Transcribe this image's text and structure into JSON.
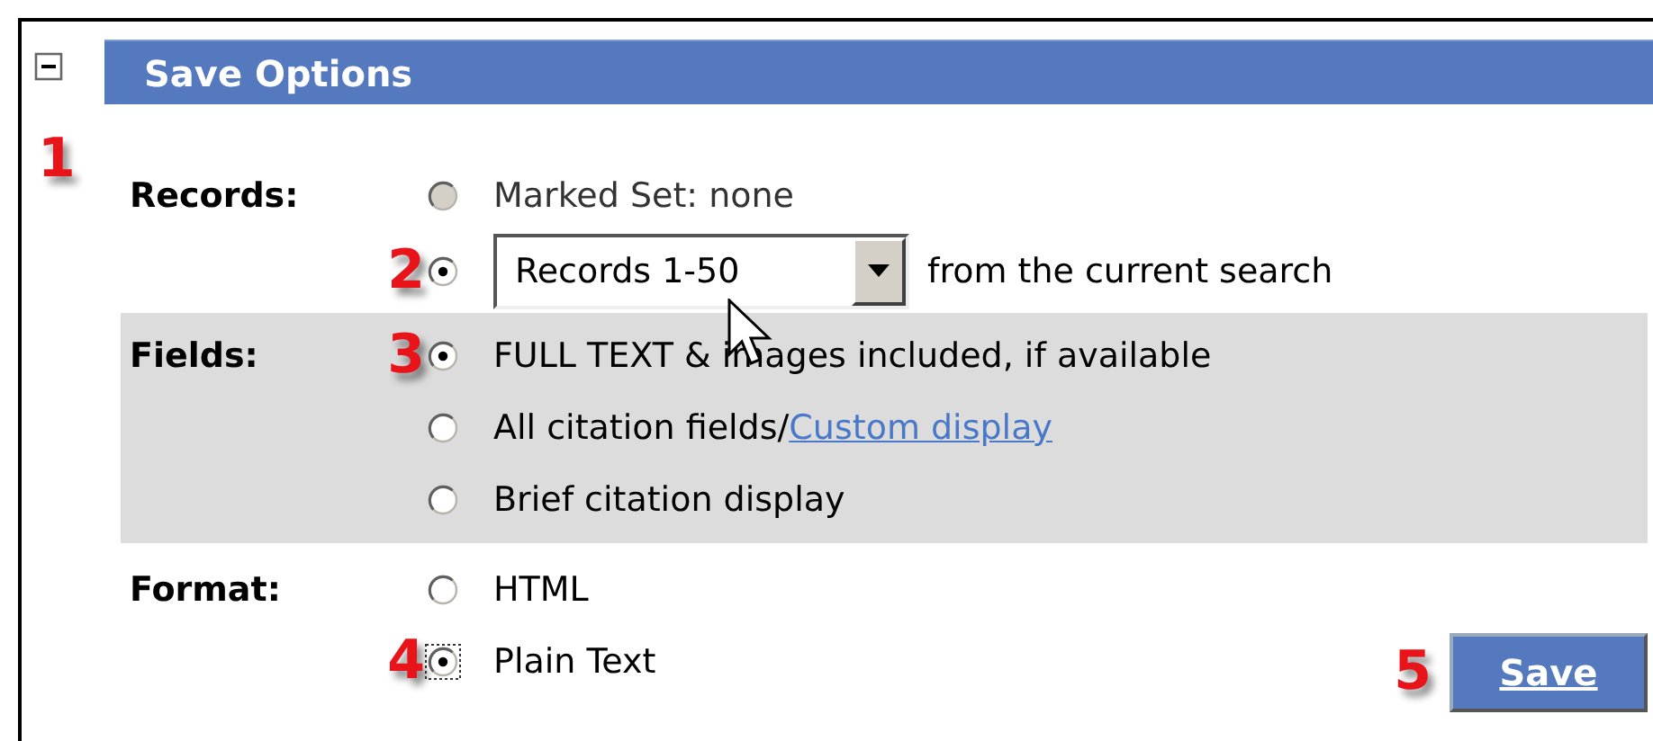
{
  "panel": {
    "title": "Save Options",
    "expanded": true,
    "callout": "1"
  },
  "sections": [
    {
      "label": "Records:",
      "shaded": false,
      "options": [
        {
          "kind": "text",
          "text": "Marked Set: none",
          "selected": false,
          "disabled": true,
          "focused": false
        },
        {
          "kind": "select",
          "value": "Records 1-50",
          "text": "from the current search",
          "selected": true,
          "disabled": false,
          "focused": false,
          "callout": "2"
        }
      ]
    },
    {
      "label": "Fields:",
      "shaded": true,
      "options": [
        {
          "kind": "text",
          "text": "FULL TEXT & images included, if available",
          "selected": true,
          "disabled": false,
          "focused": false,
          "callout": "3"
        },
        {
          "kind": "link",
          "text": "All citation fields/",
          "link": "Custom display",
          "selected": false,
          "disabled": false,
          "focused": false
        },
        {
          "kind": "text",
          "text": "Brief citation display",
          "selected": false,
          "disabled": false,
          "focused": false
        }
      ]
    },
    {
      "label": "Format:",
      "shaded": false,
      "options": [
        {
          "kind": "text",
          "text": "HTML",
          "selected": false,
          "disabled": false,
          "focused": false
        },
        {
          "kind": "text",
          "text": "Plain Text",
          "selected": true,
          "disabled": false,
          "focused": true,
          "callout": "4"
        }
      ]
    }
  ],
  "save_button": {
    "label": "Save",
    "callout": "5"
  }
}
